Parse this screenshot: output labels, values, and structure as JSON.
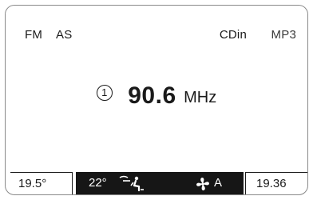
{
  "status": {
    "band": "FM",
    "as": "AS",
    "source": "CDin",
    "format": "MP3"
  },
  "radio": {
    "preset": "1",
    "frequency": "90.6",
    "unit": "MHz"
  },
  "climate": {
    "outside_temp": "19.5°",
    "set_temp": "22°",
    "airflow_icon": "air-distribution-icon",
    "fan_icon": "fan-icon",
    "mode": "A"
  },
  "clock": "19.36"
}
